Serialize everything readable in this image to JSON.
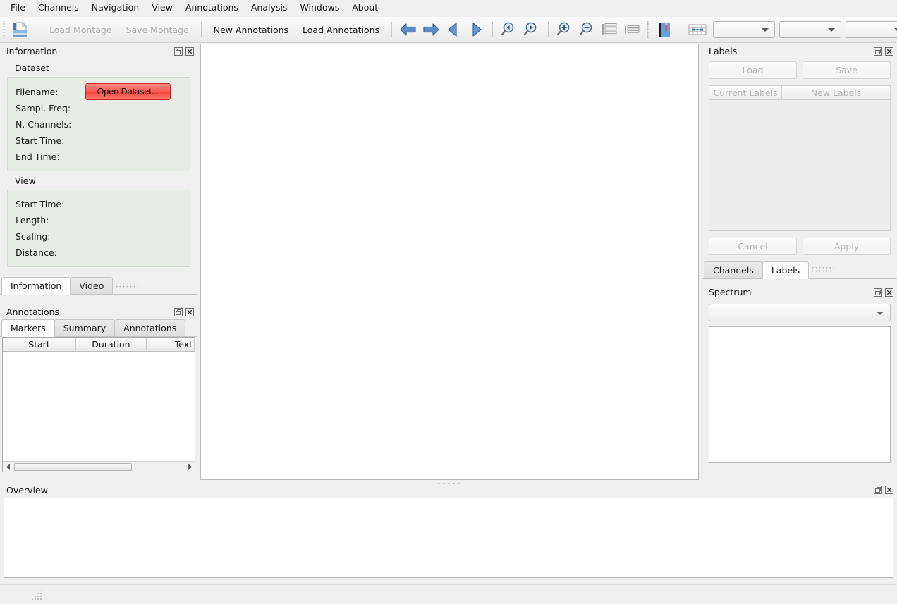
{
  "menubar": {
    "items": [
      {
        "label": "File"
      },
      {
        "label": "Channels"
      },
      {
        "label": "Navigation"
      },
      {
        "label": "View"
      },
      {
        "label": "Annotations"
      },
      {
        "label": "Analysis"
      },
      {
        "label": "Windows"
      },
      {
        "label": "About"
      }
    ]
  },
  "toolbar": {
    "open_icon": "open-dataset-folder-icon",
    "load_montage": "Load Montage",
    "save_montage": "Save Montage",
    "new_annotations": "New Annotations",
    "load_annotations": "Load Annotations",
    "icons": [
      {
        "name": "arrow-left-big-icon"
      },
      {
        "name": "arrow-right-big-icon"
      },
      {
        "name": "arrow-left-play-icon"
      },
      {
        "name": "arrow-right-play-icon"
      },
      {
        "name": "magnifier-page-left-icon"
      },
      {
        "name": "magnifier-page-right-icon"
      },
      {
        "name": "zoom-in-icon"
      },
      {
        "name": "zoom-out-icon"
      },
      {
        "name": "list-spaced-icon"
      },
      {
        "name": "list-compact-icon"
      },
      {
        "name": "book-bookmark-icon"
      },
      {
        "name": "grid-markers-icon"
      }
    ],
    "combos": [
      {
        "value": ""
      },
      {
        "value": ""
      },
      {
        "value": ""
      }
    ]
  },
  "information_panel": {
    "title": "Information",
    "dataset_group_label": "Dataset",
    "dataset_fields": [
      {
        "label": "Filename:",
        "value": ""
      },
      {
        "label": "Sampl. Freq:",
        "value": ""
      },
      {
        "label": "N. Channels:",
        "value": ""
      },
      {
        "label": "Start Time:",
        "value": ""
      },
      {
        "label": "End Time:",
        "value": ""
      }
    ],
    "open_dataset_button": "Open Dataset...",
    "view_group_label": "View",
    "view_fields": [
      {
        "label": "Start Time:",
        "value": ""
      },
      {
        "label": "Length:",
        "value": ""
      },
      {
        "label": "Scaling:",
        "value": ""
      },
      {
        "label": "Distance:",
        "value": ""
      }
    ],
    "tabs": [
      {
        "label": "Information",
        "active": true
      },
      {
        "label": "Video",
        "active": false
      }
    ]
  },
  "annotations_panel": {
    "title": "Annotations",
    "tabs": [
      {
        "label": "Markers",
        "active": true
      },
      {
        "label": "Summary",
        "active": false
      },
      {
        "label": "Annotations",
        "active": false
      }
    ],
    "columns": [
      "Start",
      "Duration",
      "Text"
    ],
    "rows": []
  },
  "labels_panel": {
    "title": "Labels",
    "load_button": "Load",
    "save_button": "Save",
    "columns": [
      "Current Labels",
      "New Labels"
    ],
    "rows": [],
    "cancel_button": "Cancel",
    "apply_button": "Apply",
    "tabs": [
      {
        "label": "Channels",
        "active": false
      },
      {
        "label": "Labels",
        "active": true
      }
    ]
  },
  "spectrum_panel": {
    "title": "Spectrum",
    "channel_select": ""
  },
  "overview_panel": {
    "title": "Overview"
  },
  "statusbar": {
    "message": ""
  },
  "colors": {
    "window_background": "#efefef",
    "canvas_background": "#ffffff",
    "group_background": "#e7ece7",
    "open_button_accent": "#f1453c",
    "disabled_text": "#b0b0b0",
    "border": "#b9b9b9"
  }
}
